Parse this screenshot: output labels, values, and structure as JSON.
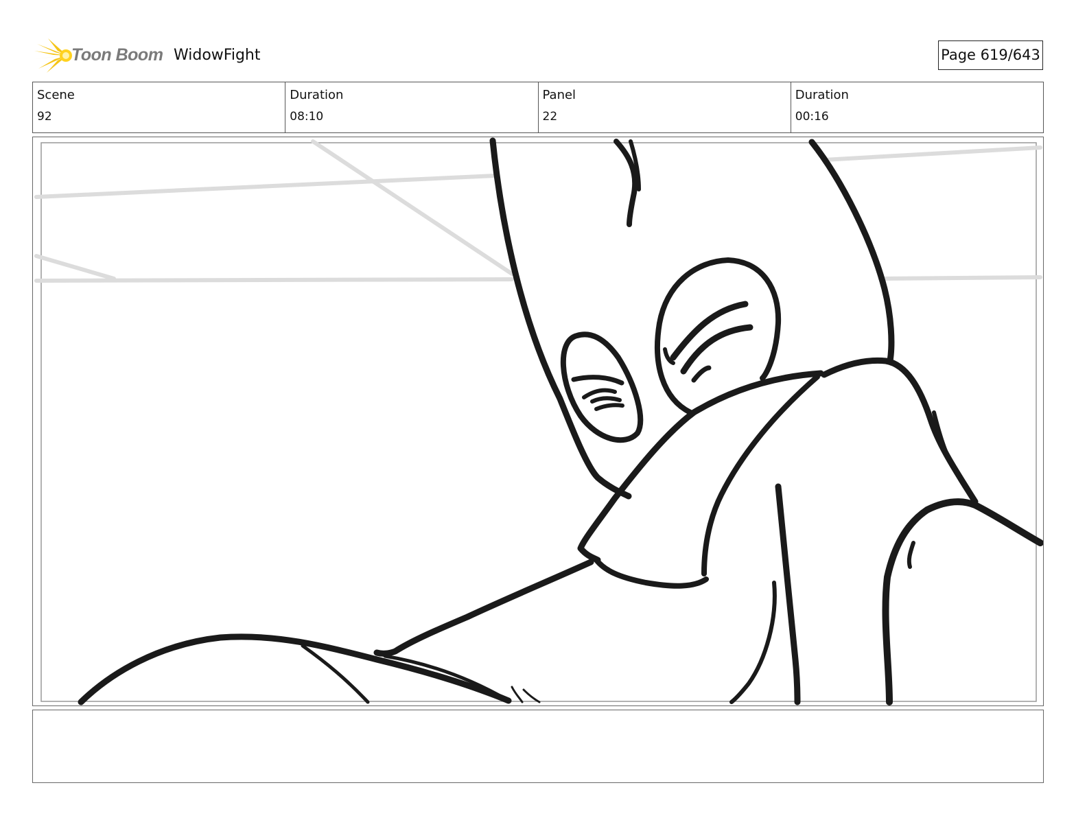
{
  "header": {
    "brand": "Toon Boom",
    "project": "WidowFight",
    "page": "Page 619/643"
  },
  "info": [
    {
      "label": "Scene",
      "value": "92"
    },
    {
      "label": "Duration",
      "value": "08:10"
    },
    {
      "label": "Panel",
      "value": "22"
    },
    {
      "label": "Duration",
      "value": "00:16"
    }
  ],
  "notes": "",
  "colors": {
    "logo_yellow": "#f5c518",
    "line": "#1a1a1a",
    "guide": "#dcdcdc"
  },
  "icons": {
    "logo": "toon-boom-star-icon"
  }
}
